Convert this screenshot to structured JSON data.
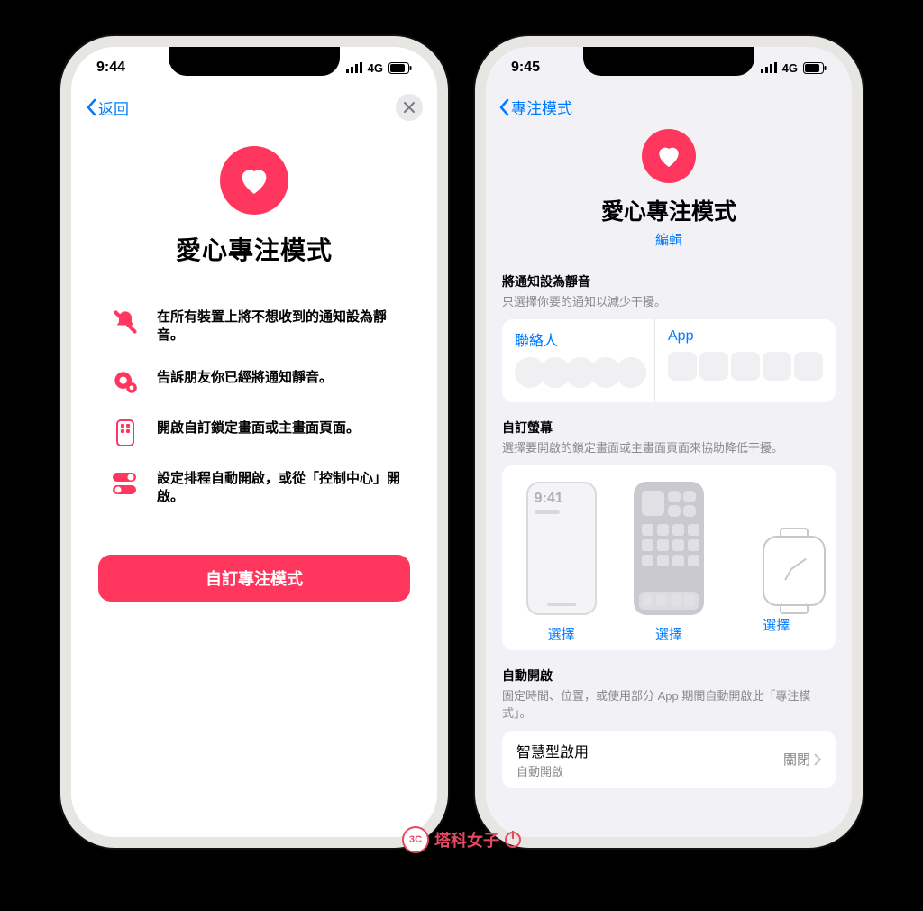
{
  "watermark_text": "塔科女子",
  "phone_left": {
    "status": {
      "time": "9:44",
      "carrier": "4G"
    },
    "nav": {
      "back": "返回"
    },
    "hero": {
      "title": "愛心專注模式"
    },
    "bullets": [
      "在所有裝置上將不想收到的通知設為靜音。",
      "告訴朋友你已經將通知靜音。",
      "開啟自訂鎖定畫面或主畫面頁面。",
      "設定排程自動開啟，或從「控制中心」開啟。"
    ],
    "cta": "自訂專注模式"
  },
  "phone_right": {
    "status": {
      "time": "9:45",
      "carrier": "4G"
    },
    "nav": {
      "back": "專注模式"
    },
    "hero": {
      "title": "愛心專注模式",
      "edit": "編輯"
    },
    "sec_silence": {
      "heading": "將通知設為靜音",
      "sub": "只選擇你要的通知以減少干擾。",
      "contacts": "聯絡人",
      "apps": "App"
    },
    "sec_screens": {
      "heading": "自訂螢幕",
      "sub": "選擇要開啟的鎖定畫面或主畫面頁面來協助降低干擾。",
      "lock_time": "9:41",
      "select": "選擇"
    },
    "sec_auto": {
      "heading": "自動開啟",
      "sub": "固定時間、位置，或使用部分 App 期間自動開啟此「專注模式」。",
      "smart_title": "智慧型啟用",
      "smart_sub": "自動開啟",
      "smart_value": "關閉"
    }
  }
}
